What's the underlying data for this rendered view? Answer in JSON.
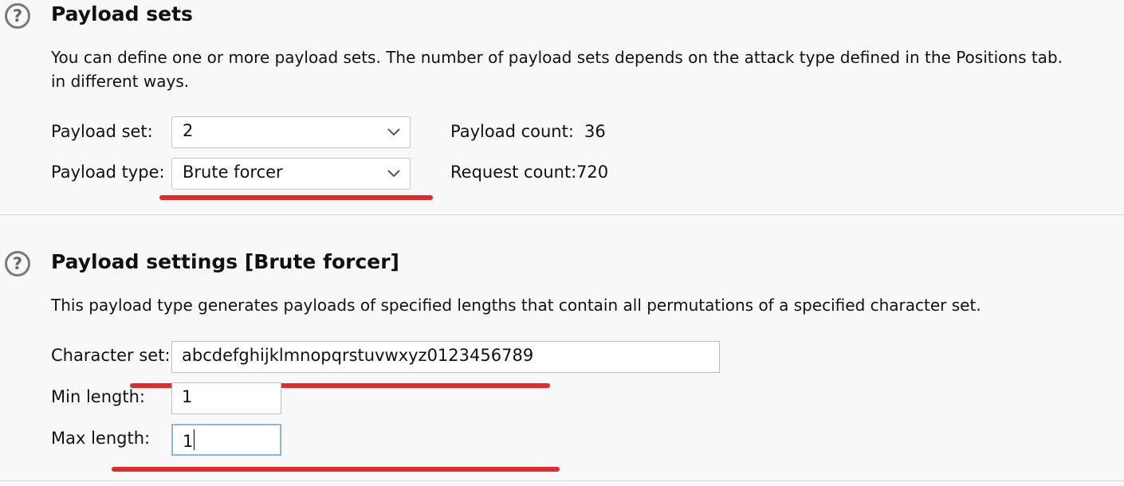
{
  "payload_sets": {
    "title": "Payload sets",
    "description_line1": "You can define one or more payload sets. The number of payload sets depends on the attack type defined in the Positions tab.",
    "description_line2": "in different ways.",
    "payload_set_label": "Payload set:",
    "payload_set_value": "2",
    "payload_type_label": "Payload type:",
    "payload_type_value": "Brute forcer",
    "payload_count_label": "Payload count:",
    "payload_count_value": "36",
    "request_count_label": "Request count:",
    "request_count_value": "720"
  },
  "payload_settings": {
    "title": "Payload settings [Brute forcer]",
    "description": "This payload type generates payloads of specified lengths that contain all permutations of a specified character set.",
    "character_set_label": "Character set:",
    "character_set_value": "abcdefghijklmnopqrstuvwxyz0123456789",
    "min_length_label": "Min length:",
    "min_length_value": "1",
    "max_length_label": "Max length:",
    "max_length_value": "1"
  },
  "icons": {
    "help": "help-circle-icon",
    "dropdown": "chevron-down-icon"
  },
  "colors": {
    "background": "#f8f8f8",
    "annotation": "#e12b2b",
    "focus_border": "#8ab6d8"
  }
}
